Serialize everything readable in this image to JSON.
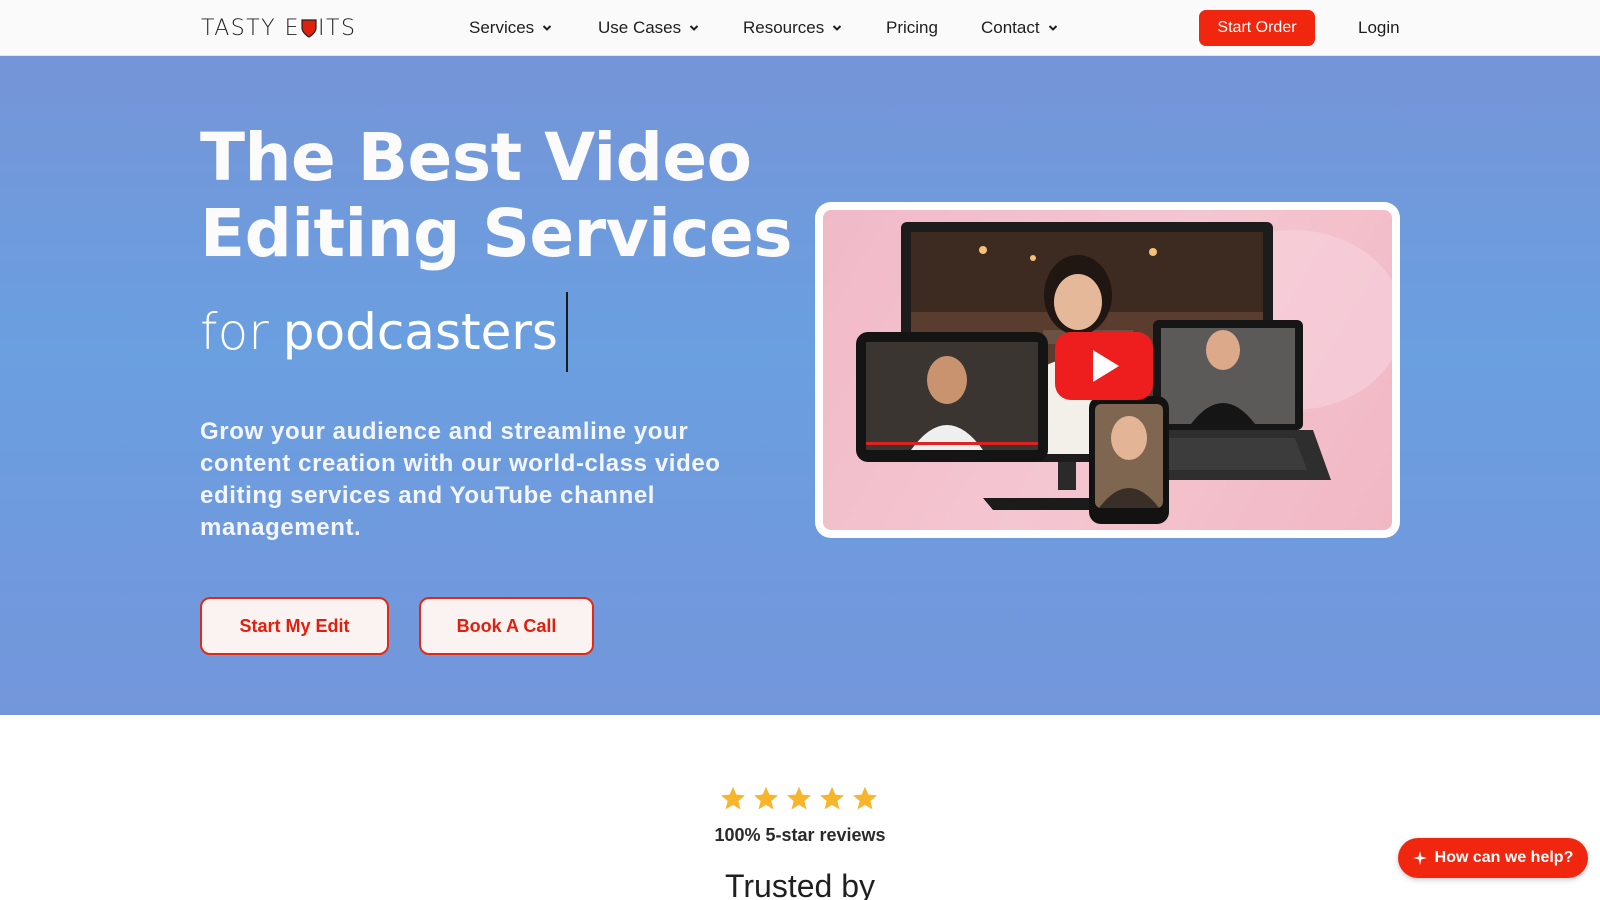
{
  "nav": {
    "logo_left": "TASTY E",
    "logo_right": "ITS",
    "items": [
      {
        "label": "Services",
        "dropdown": true
      },
      {
        "label": "Use Cases",
        "dropdown": true
      },
      {
        "label": "Resources",
        "dropdown": true
      },
      {
        "label": "Pricing",
        "dropdown": false
      },
      {
        "label": "Contact",
        "dropdown": true
      }
    ],
    "start_order": "Start Order",
    "login": "Login"
  },
  "hero": {
    "title_line1": "The Best Video",
    "title_line2": "Editing Services",
    "sub_prefix": "for",
    "sub_typed": "podcasters",
    "description": "Grow your audience and streamline your content creation with our world-class video editing services and YouTube channel management.",
    "cta_primary": "Start My Edit",
    "cta_secondary": "Book A Call"
  },
  "social_proof": {
    "star_count": 5,
    "reviews": "100% 5-star reviews",
    "trusted": "Trusted by"
  },
  "help": {
    "label": "How can we help?"
  },
  "colors": {
    "brand_red": "#f0260e",
    "hero_blue": "#6a9fe0",
    "star_gold": "#f7b52c"
  }
}
